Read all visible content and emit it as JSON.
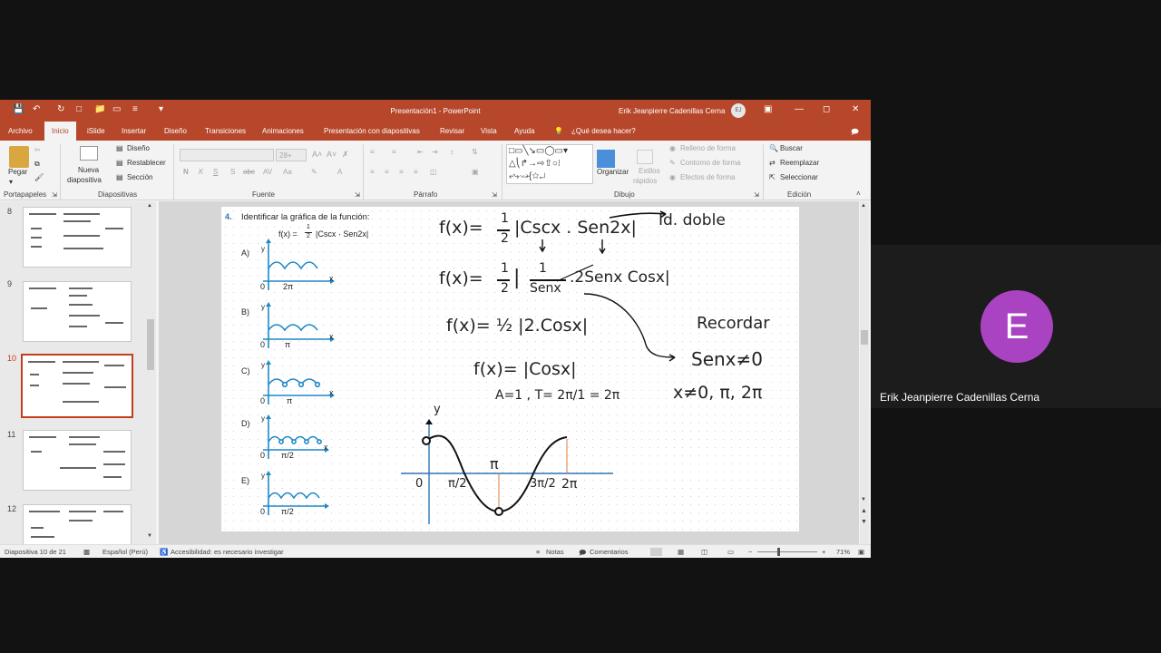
{
  "window": {
    "doc_title": "Presentación1 - PowerPoint",
    "user_name": "Erik Jeanpierre Cadenillas Cerna",
    "user_initials": "EJ"
  },
  "tabs": [
    "Archivo",
    "Inicio",
    "iSlide",
    "Insertar",
    "Diseño",
    "Transiciones",
    "Animaciones",
    "Presentación con diapositivas",
    "Revisar",
    "Vista",
    "Ayuda"
  ],
  "tell_me": "¿Qué desea hacer?",
  "ribbon": {
    "paste": "Pegar",
    "new_slide_1": "Nueva",
    "new_slide_2": "diapositiva",
    "layout": "Diseño",
    "reset": "Restablecer",
    "section": "Sección",
    "font_size": "28+",
    "arrange": "Organizar",
    "quick_styles_1": "Estilos",
    "quick_styles_2": "rápidos",
    "shape_fill": "Relleno de forma",
    "shape_outline": "Contorno de forma",
    "shape_effects": "Efectos de forma",
    "find": "Buscar",
    "replace": "Reemplazar",
    "select": "Seleccionar",
    "groups": {
      "clipboard": "Portapapeles",
      "slides": "Diapositivas",
      "font": "Fuente",
      "paragraph": "Párrafo",
      "drawing": "Dibujo",
      "editing": "Edición"
    }
  },
  "thumbnails": [
    "8",
    "9",
    "10",
    "11",
    "12"
  ],
  "slide": {
    "question_number": "4.",
    "question_text": "Identificar la gráfica de la función:",
    "function_lhs": "f(x) =",
    "frac_num": "1",
    "frac_den": "2",
    "function_rhs": "|Cscx · Sen2x|",
    "options": [
      {
        "letter": "A)",
        "mark": "2π"
      },
      {
        "letter": "B)",
        "mark": "π"
      },
      {
        "letter": "C)",
        "mark": "π"
      },
      {
        "letter": "D)",
        "mark": "π/2"
      },
      {
        "letter": "E)",
        "mark": "π/2"
      }
    ],
    "axis_x": "x",
    "axis_y": "y",
    "origin": "0",
    "handwriting": {
      "line1_lhs": "f(x)=",
      "line1_rhs": "|Cscx . Sen2x|",
      "identity": "Id. doble",
      "line2_lhs": "f(x)=",
      "line2_one": "1",
      "line2_den": "Senx",
      "line2_rest": ".2Senx Cosx|",
      "line3": "f(x)= ½ |2.Cosx|",
      "line4": "f(x)= |Cosx|",
      "line5": "A=1 , T= 2π/1 = 2π",
      "remember": "Recordar",
      "cond1": "Senx≠0",
      "cond2": "x≠0, π, 2π",
      "graph_labels": {
        "y": "y",
        "zero": "0",
        "pi": "π",
        "pi_half": "π/2",
        "three_pi_half": "3π/2",
        "two_pi": "2π"
      }
    }
  },
  "status": {
    "slide_counter": "Diapositiva 10 de 21",
    "language": "Español (Perú)",
    "accessibility": "Accesibilidad: es necesario investigar",
    "notes": "Notas",
    "comments": "Comentarios",
    "zoom": "71%"
  },
  "participant": {
    "initial": "E",
    "name": "Erik Jeanpierre Cadenillas Cerna",
    "avatar_color": "#a943c2"
  }
}
